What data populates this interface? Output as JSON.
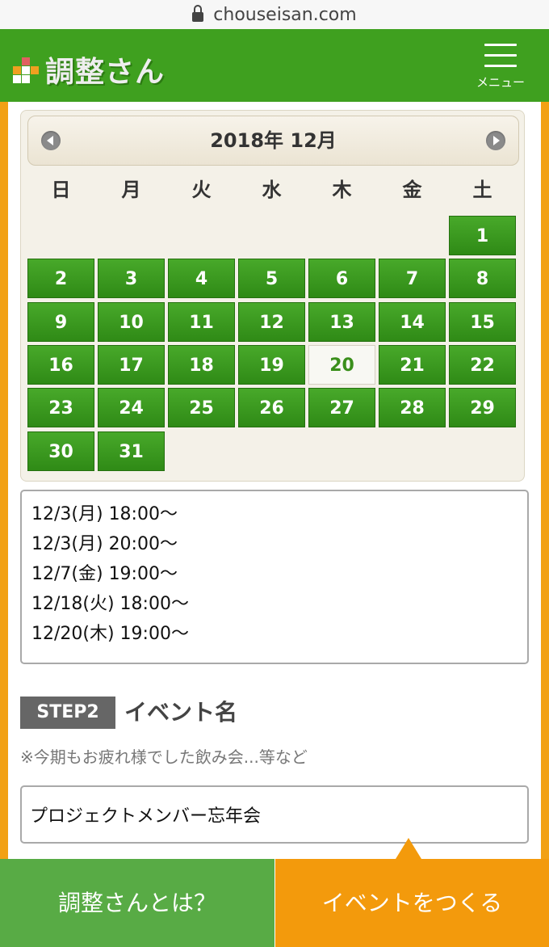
{
  "browser": {
    "url": "chouseisan.com"
  },
  "header": {
    "logo_text": "調整さん",
    "menu_label": "メニュー"
  },
  "colors": {
    "header_green": "#3fa01f",
    "day_green": "#3a9a1e",
    "accent_orange": "#f39a0c"
  },
  "calendar": {
    "title": "2018年 12月",
    "weekdays": [
      "日",
      "月",
      "火",
      "水",
      "木",
      "金",
      "土"
    ],
    "first_weekday_index": 6,
    "days_in_month": 31,
    "highlighted_day": 20
  },
  "dates_text": [
    "12/3(月) 18:00〜",
    "12/3(月) 20:00〜",
    "12/7(金) 19:00〜",
    "12/18(火) 18:00〜",
    "12/20(木) 19:00〜"
  ],
  "step2": {
    "badge": "STEP2",
    "title": "イベント名",
    "hint": "※今期もお疲れ様でした飲み会...等など",
    "event_name_value": "プロジェクトメンバー忘年会"
  },
  "bottom": {
    "about_label": "調整さんとは？",
    "create_label": "イベントをつくる"
  }
}
